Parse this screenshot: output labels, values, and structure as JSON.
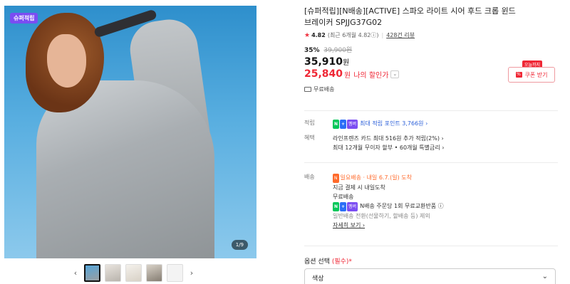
{
  "gallery": {
    "badge": "슈퍼적립",
    "counter": "1/9",
    "prev_icon": "‹",
    "next_icon": "›",
    "thumb_count": 5
  },
  "product": {
    "title": "[슈퍼적립][N배송][ACTIVE] 스파오 라이트 시어 후드 크롭 윈드브레이커 SPJJG37G02",
    "rating": "4.82",
    "rating_detail": "(최근 6개월 4.82ⓘ)",
    "review_count": "428건 리뷰",
    "discount_pct": "35%",
    "original_price": "39,900원",
    "price": "35,910",
    "price_unit": "원",
    "my_price": "25,840",
    "my_price_unit": "원",
    "my_price_label": "나의 할인가",
    "my_price_chevron": "⌄",
    "free_shipping": "무료배송"
  },
  "coupon": {
    "tag": "오늘까지",
    "icon": "%",
    "label": "쿠폰 받기"
  },
  "benefits": {
    "points_label": "적립",
    "npay_chip": "N",
    "plus_chip": "+",
    "member_chip": "멤버",
    "points_text": "최대 적립 포인트 3,766원 ›",
    "benefit_label": "혜택",
    "benefit_line1": "라인프렌즈 카드 최대 516원 추가 적립(2%) ›",
    "benefit_line2": "최대 12개월 무이자 할부 • 60개월 특별금리 ›"
  },
  "shipping": {
    "label": "배송",
    "chip": "N",
    "arrival_text": "일요배송 · 내일 6.7.(일) 도착",
    "line1": "지금 결제 시 내일도착",
    "line2": "무료배송",
    "npay_chip": "N",
    "plus_chip": "+",
    "member_chip": "멤버",
    "line3": "N배송 주문당 1회 무료교환반품 ⓘ",
    "line4": "일반배송 전환(선물하기, 할배송 등) 제외",
    "detail_link": "자세히 보기 ›"
  },
  "options": {
    "label": "옵션 선택",
    "required": "(필수)*",
    "select_value": "색상",
    "chevron": "⌄"
  }
}
